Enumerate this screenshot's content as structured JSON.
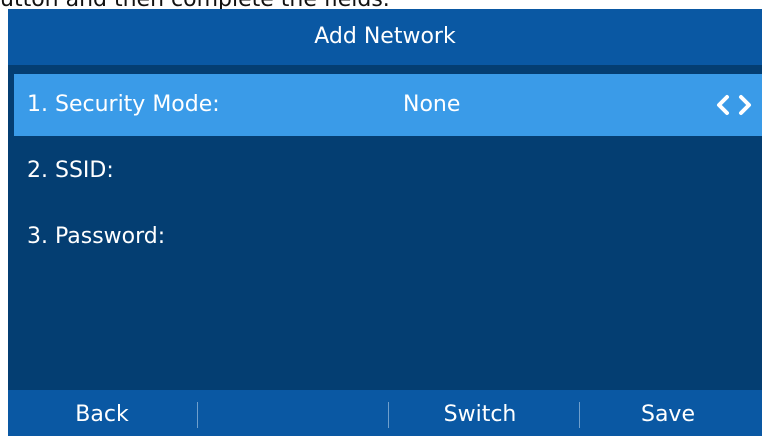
{
  "caption": "utton and then complete the fields.",
  "screen": {
    "title": "Add Network",
    "fields": [
      {
        "label": "1. Security Mode:",
        "value": "None"
      },
      {
        "label": "2. SSID:",
        "value": ""
      },
      {
        "label": "3. Password:",
        "value": ""
      }
    ],
    "softkeys": [
      "Back",
      "",
      "Switch",
      "Save"
    ]
  },
  "colors": {
    "screen_background": "#043e72",
    "bar_background": "#0a58a3",
    "selected_row": "#3a9be8",
    "text": "#ffffff"
  },
  "icons": {
    "prev": "chevron-left-icon",
    "next": "chevron-right-icon"
  }
}
